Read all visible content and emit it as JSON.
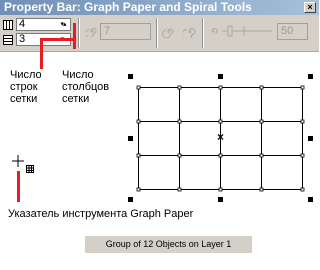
{
  "window": {
    "title": "Property Bar: Graph Paper and Spiral Tools",
    "close_glyph": "×"
  },
  "toolbar": {
    "columns_value": "4",
    "rows_value": "3",
    "spiral_revolutions_value": "7",
    "expansion_value": "50",
    "spin_arrows": "▾▴"
  },
  "annotations": {
    "rows_label": [
      "Число",
      "строк",
      "сетки"
    ],
    "columns_label": [
      "Число",
      "столбцов",
      "сетки"
    ],
    "pointer_label": "Указатель инструмента Graph Paper"
  },
  "canvas": {
    "grid_columns": 4,
    "grid_rows": 3,
    "center_mark": "×"
  },
  "status_bar": {
    "text": "Group of 12 Objects on Layer 1"
  },
  "icons": {
    "columns": "grid-columns-icon",
    "rows": "grid-rows-icon",
    "spiral_revolutions": "spiral-icon",
    "symmetrical_spiral": "symmetrical-spiral-icon",
    "logarithmic_spiral": "logarithmic-spiral-icon",
    "expansion": "expansion-slider-icon",
    "cursor": "graph-paper-cursor-icon"
  },
  "colors": {
    "title_bar": "#6f8fb4",
    "annotation": "#e41e24",
    "toolbar_bg": "#d4d0c8"
  }
}
